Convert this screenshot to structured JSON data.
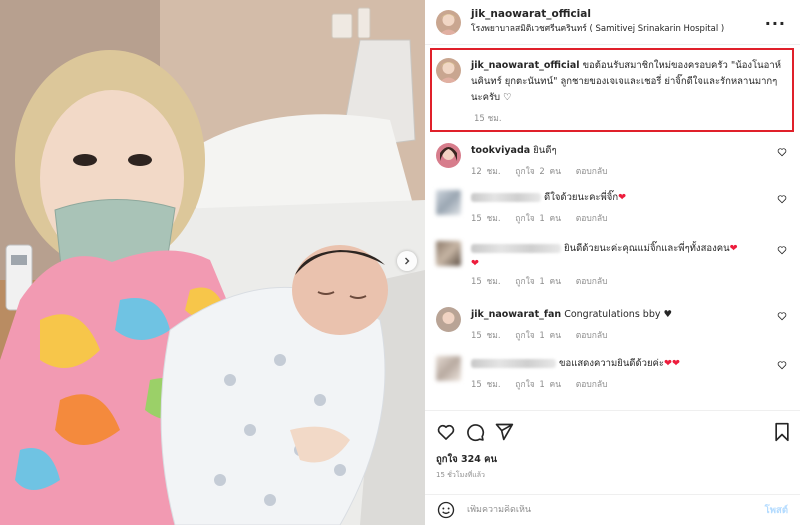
{
  "post": {
    "username": "jik_naowarat_official",
    "location": "โรงพยาบาลสมิติเวชศรีนครินทร์ ( Samitivej Srinakarin Hospital )",
    "more_icon": "more-dots-icon"
  },
  "caption": {
    "username": "jik_naowarat_official",
    "text": "ขอต้อนรับสมาชิกใหม่ของครอบครัว \"น้องโนอาห์ นคินทร์ ยุกตะนันทน์\" ลูกชายของเจเจและเชอรี่ ย่าจิ๊กดีใจและรักหลานมากๆนะครับ",
    "emoji": "♡",
    "time": "15 ชม."
  },
  "comments": [
    {
      "username": "tookviyada",
      "text": "ยินดีๆ",
      "time": "12 ชม.",
      "likes": "ถูกใจ 2 คน",
      "reply": "ตอบกลับ",
      "blurred": false
    },
    {
      "username": "",
      "text": "ดีใจด้วยนะคะพี่จิ๊ก",
      "emoji": "❤",
      "time": "15 ชม.",
      "likes": "ถูกใจ 1 คน",
      "reply": "ตอบกลับ",
      "blurred": true
    },
    {
      "username": "",
      "text": "ยินดีด้วยนะค่ะคุณแม่จิ๊กและพี่ๆทั้งสองคน",
      "emoji": "❤",
      "emoji2": "❤",
      "time": "15 ชม.",
      "likes": "ถูกใจ 1 คน",
      "reply": "ตอบกลับ",
      "blurred": true
    },
    {
      "username": "jik_naowarat_fan",
      "text": "Congratulations bby",
      "emoji": "♥",
      "time": "15 ชม.",
      "likes": "ถูกใจ 1 คน",
      "reply": "ตอบกลับ",
      "blurred": false
    },
    {
      "username": "",
      "text": "ขอแสดงความยินดีด้วยค่ะ",
      "emoji": "❤❤",
      "time": "15 ชม.",
      "likes": "ถูกใจ 1 คน",
      "reply": "ตอบกลับ",
      "blurred": true
    }
  ],
  "actions": {
    "like_icon": "heart-outline-icon",
    "comment_icon": "comment-bubble-icon",
    "share_icon": "paper-plane-icon",
    "save_icon": "bookmark-icon"
  },
  "likes": "ถูกใจ 324 คน",
  "posted_ago": "15 ชั่วโมงที่แล้ว",
  "add_comment": {
    "placeholder": "เพิ่มความคิดเห็น",
    "post_label": "โพสต์",
    "emoji_icon": "smiley-icon"
  },
  "colors": {
    "highlight_border": "#e0202a",
    "heart_red": "#ed1c3c",
    "post_button": "#b3dbff"
  }
}
